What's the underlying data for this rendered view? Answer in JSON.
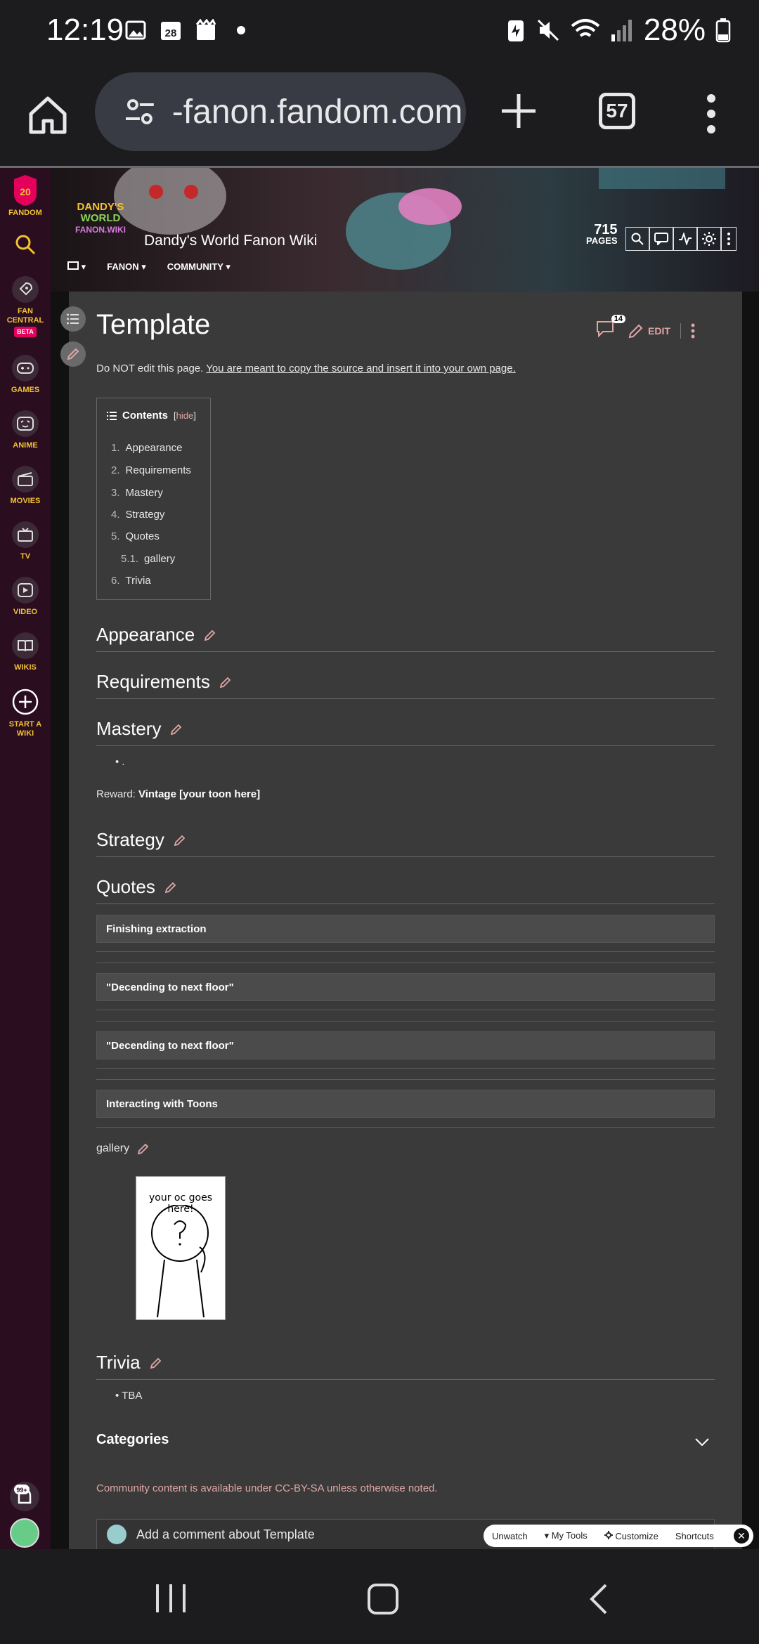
{
  "status": {
    "time": "12:19",
    "calendar_day": "28",
    "battery": "28%"
  },
  "browser": {
    "url": "-fanon.fandom.com",
    "tabs_count": "57"
  },
  "rail": {
    "badge": "20",
    "items": [
      {
        "label": "FANDOM",
        "icon": "fandom-logo-icon"
      },
      {
        "label": "",
        "icon": "search-icon"
      },
      {
        "label": "FAN CENTRAL",
        "icon": "rocket-icon",
        "badge": "BETA"
      },
      {
        "label": "GAMES",
        "icon": "gamepad-icon"
      },
      {
        "label": "ANIME",
        "icon": "anime-icon"
      },
      {
        "label": "MOVIES",
        "icon": "clapper-icon"
      },
      {
        "label": "TV",
        "icon": "tv-icon"
      },
      {
        "label": "VIDEO",
        "icon": "play-icon"
      },
      {
        "label": "WIKIS",
        "icon": "book-icon"
      },
      {
        "label": "START A WIKI",
        "icon": "plus-circle-icon"
      }
    ],
    "notifications": "99+"
  },
  "wiki": {
    "logo_line1": "DANDY'S",
    "logo_line2": "WORLD",
    "logo_line3": "FANON.WIKI",
    "title": "Dandy's World Fanon Wiki",
    "nav": [
      "FANON",
      "COMMUNITY"
    ],
    "pages_count": "715",
    "pages_label": "PAGES"
  },
  "article": {
    "title": "Template",
    "comments_count": "14",
    "edit_label": "EDIT",
    "intro_plain": "Do NOT edit this page. ",
    "intro_link": "You are meant to copy the source and insert it into your own page.",
    "toc": {
      "title": "Contents",
      "hide": "hide",
      "items": [
        {
          "num": "1.",
          "label": "Appearance"
        },
        {
          "num": "2.",
          "label": "Requirements"
        },
        {
          "num": "3.",
          "label": "Mastery"
        },
        {
          "num": "4.",
          "label": "Strategy"
        },
        {
          "num": "5.",
          "label": "Quotes"
        },
        {
          "num": "5.1.",
          "label": "gallery"
        },
        {
          "num": "6.",
          "label": "Trivia"
        }
      ]
    },
    "headings": {
      "appearance": "Appearance",
      "requirements": "Requirements",
      "mastery": "Mastery",
      "strategy": "Strategy",
      "quotes": "Quotes",
      "trivia": "Trivia"
    },
    "mastery_bullet": ".",
    "reward_label": "Reward: ",
    "reward_value": "Vintage [your toon here]",
    "quotes": [
      "Finishing extraction",
      "\"Decending to next floor\"",
      "\"Decending to next floor\"",
      "Interacting with Toons"
    ],
    "gallery_heading": "gallery",
    "gallery_caption": "your oc goes here!",
    "trivia_bullet": "TBA",
    "categories": "Categories",
    "license_pre": "Community content is available under ",
    "license_link": "CC-BY-SA",
    "license_post": " unless otherwise noted.",
    "comment_prompt": "Add a comment about Template"
  },
  "toolbar": {
    "unwatch": "Unwatch",
    "my_tools": "My Tools",
    "customize": "Customize",
    "shortcuts": "Shortcuts"
  }
}
